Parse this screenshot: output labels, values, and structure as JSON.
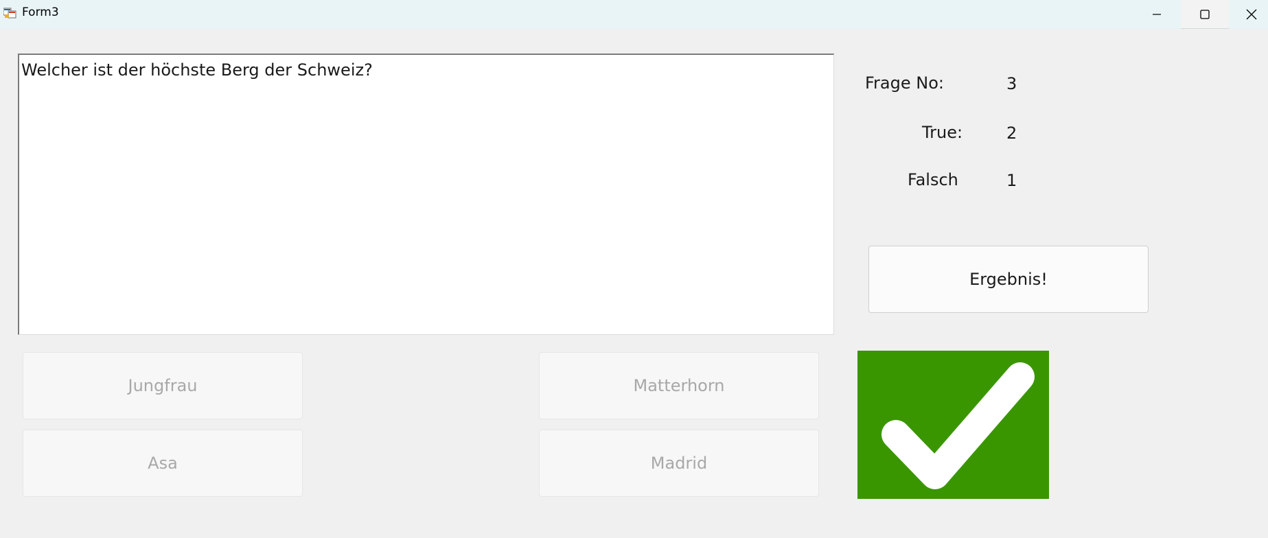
{
  "window": {
    "title": "Form3",
    "icon": "form-app-icon"
  },
  "question": {
    "text": "Welcher ist der höchste Berg der Schweiz?"
  },
  "stats": {
    "frage_label": "Frage No:",
    "frage_value": "3",
    "true_label": "True:",
    "true_value": "2",
    "falsch_label": "Falsch",
    "falsch_value": "1"
  },
  "result_button": {
    "label": "Ergebnis!"
  },
  "answers": [
    {
      "label": "Jungfrau"
    },
    {
      "label": "Matterhorn"
    },
    {
      "label": "Asa"
    },
    {
      "label": "Madrid"
    }
  ],
  "feedback": {
    "icon": "checkmark-icon",
    "color": "#3a9600"
  }
}
